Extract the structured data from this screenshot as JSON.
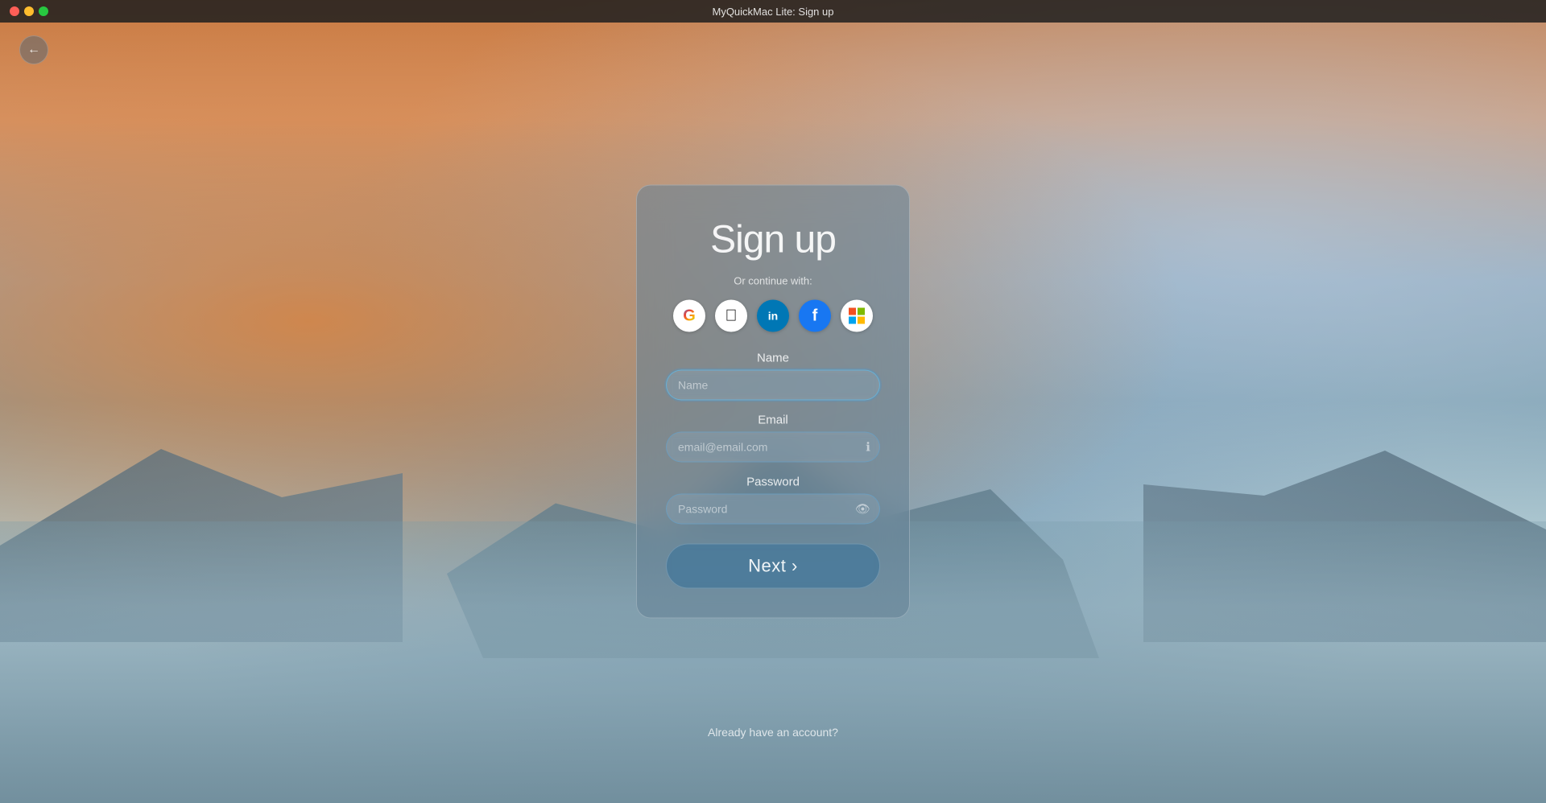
{
  "window": {
    "title": "MyQuickMac Lite: Sign up"
  },
  "trafficLights": {
    "close": "close",
    "minimize": "minimize",
    "maximize": "maximize"
  },
  "backButton": {
    "label": "←"
  },
  "card": {
    "title": "Sign up",
    "orContinue": "Or continue with:",
    "social": [
      {
        "id": "google",
        "label": "G",
        "title": "Google"
      },
      {
        "id": "apple",
        "label": "",
        "title": "Apple"
      },
      {
        "id": "linkedin",
        "label": "in",
        "title": "LinkedIn"
      },
      {
        "id": "facebook",
        "label": "f",
        "title": "Facebook"
      },
      {
        "id": "microsoft",
        "label": "",
        "title": "Microsoft"
      }
    ],
    "fields": {
      "name": {
        "label": "Name",
        "placeholder": "Name",
        "value": ""
      },
      "email": {
        "label": "Email",
        "placeholder": "email@email.com",
        "value": ""
      },
      "password": {
        "label": "Password",
        "placeholder": "Password",
        "value": ""
      }
    },
    "nextButton": "Next ›",
    "alreadyAccount": "Already have an account?"
  }
}
